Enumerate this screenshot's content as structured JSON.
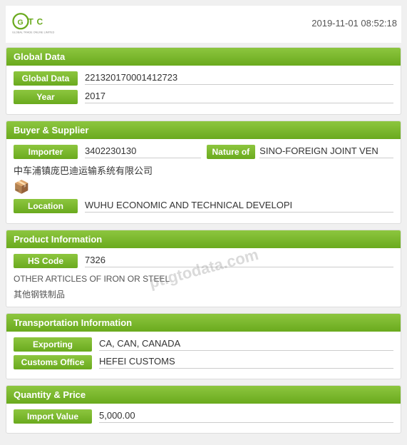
{
  "header": {
    "datetime": "2019-11-01 08:52:18"
  },
  "global_data_section": {
    "title": "Global Data",
    "fields": [
      {
        "label": "Global Data",
        "value": "221320170001412723"
      },
      {
        "label": "Year",
        "value": "2017"
      }
    ]
  },
  "buyer_supplier_section": {
    "title": "Buyer & Supplier",
    "importer_label": "Importer",
    "importer_value": "3402230130",
    "nature_label": "Nature of",
    "nature_value": "SINO-FOREIGN JOINT VEN",
    "company_name": "中车浦镇庞巴迪运输系统有限公司",
    "company_icon": "📦",
    "location_label": "Location",
    "location_value": "WUHU ECONOMIC AND TECHNICAL DEVELOPI"
  },
  "product_section": {
    "title": "Product Information",
    "hs_label": "HS Code",
    "hs_value": "7326",
    "hs_desc_en": "OTHER ARTICLES OF IRON OR STEEL",
    "hs_desc_cn": "其他钢铁制品",
    "watermark": "pt.gtodata.com"
  },
  "transport_section": {
    "title": "Transportation Information",
    "exporting_label": "Exporting",
    "exporting_value": "CA, CAN, CANADA",
    "customs_label": "Customs Office",
    "customs_value": "HEFEI CUSTOMS"
  },
  "qty_price_section": {
    "title": "Quantity & Price",
    "import_value_label": "Import Value",
    "import_value": "5,000.00"
  }
}
